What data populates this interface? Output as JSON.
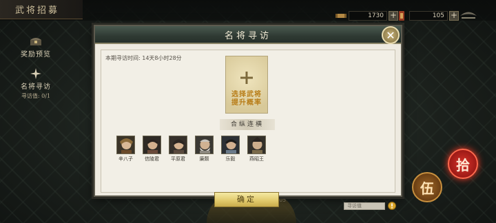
{
  "top_bar": {
    "title": "武将招募",
    "resource_1": {
      "value": "1730",
      "icon": "scroll-icon"
    },
    "resource_2": {
      "value": "105",
      "icon": "token-icon"
    },
    "plus_label": "+"
  },
  "left_menu": {
    "rewards_label": "奖励预览",
    "visit_label": "名将寻访",
    "visit_count": "寻访值: 0/1"
  },
  "dialog": {
    "title": "名将寻访",
    "close_label": "✕",
    "visit_time": "本期寻访时间: 14天8小时28分",
    "select_hint_line1": "选择武将",
    "select_hint_line2": "提升概率",
    "alliance_label": "合纵连横",
    "generals": [
      {
        "name": "辛八子",
        "color": "#8a6a3a"
      },
      {
        "name": "信陵君",
        "color": "#6a4a3a"
      },
      {
        "name": "平原君",
        "color": "#5a4a3e"
      },
      {
        "name": "廉颇",
        "color": "#8c8880"
      },
      {
        "name": "乐毅",
        "color": "#6a7a8a"
      },
      {
        "name": "燕昭王",
        "color": "#7a6a4a"
      }
    ],
    "confirm_label": "确定",
    "visit_value_label": "寻访值"
  },
  "seals": {
    "red": "拾",
    "brown": "伍"
  },
  "bottom_number": "105"
}
